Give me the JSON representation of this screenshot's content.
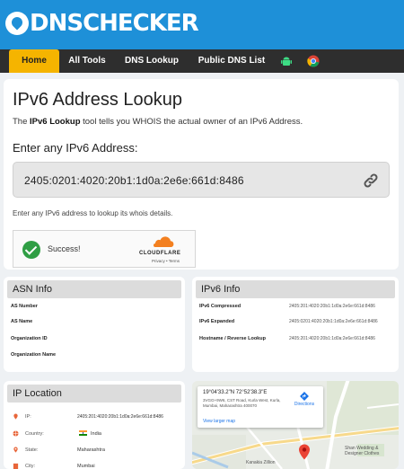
{
  "brand": {
    "dns": "DNS",
    "checker": "CHECKER"
  },
  "nav": {
    "items": [
      {
        "label": "Home",
        "active": true
      },
      {
        "label": "All Tools"
      },
      {
        "label": "DNS Lookup"
      },
      {
        "label": "Public DNS List"
      }
    ],
    "icons": [
      "android-icon",
      "chrome-icon"
    ]
  },
  "main": {
    "title": "IPv6 Address Lookup",
    "intro_pre": "The ",
    "intro_bold": "IPv6 Lookup",
    "intro_post": " tool tells you WHOIS the actual owner of an IPv6 Address.",
    "enter_label": "Enter any IPv6 Address:",
    "ip_value": "2405:0201:4020:20b1:1d0a:2e6e:661d:8486",
    "hint": "Enter any IPv6 address to lookup its whois details."
  },
  "turnstile": {
    "status": "Success!",
    "brand": "CLOUDFLARE",
    "links": "Privacy • Terms"
  },
  "asn": {
    "title": "ASN Info",
    "rows": [
      {
        "label": "AS Number",
        "value": ""
      },
      {
        "label": "AS Name",
        "value": ""
      },
      {
        "label": "Organization ID",
        "value": ""
      },
      {
        "label": "Organization Name",
        "value": ""
      }
    ]
  },
  "ipv6_info": {
    "title": "IPv6 Info",
    "rows": [
      {
        "label": "IPv6 Compressed",
        "value": "2405:201:4020:20b1:1d0a:2e6e:661d:8486"
      },
      {
        "label": "IPv6 Expanded",
        "value": "2405:0201:4020:20b1:1d0a:2e6e:661d:8486"
      },
      {
        "label": "Hostname / Reverse Lookup",
        "value": "2405:201:4020:20b1:1d0a:2e6e:661d:8486"
      }
    ]
  },
  "location": {
    "title": "IP Location",
    "rows": [
      {
        "label": "IP:",
        "value": "2405:201:4020:20b1:1d0a:2e6e:661d:8486",
        "icon": "map-pin-icon"
      },
      {
        "label": "Country:",
        "value": "India",
        "icon": "globe-icon"
      },
      {
        "label": "State:",
        "value": "Maharashtra",
        "icon": "location-icon"
      },
      {
        "label": "City:",
        "value": "Mumbai",
        "icon": "building-icon"
      }
    ]
  },
  "map": {
    "coord": "19°04'33.2\"N 72°52'38.3\"E",
    "address": "3VGG+9W6, CST Road, Kurla West, Kurla, Mumbai, Maharashtra 400070",
    "larger_link": "View larger map",
    "directions": "Directions",
    "places": [
      "Kanakia Zillion",
      "Shan Wedding & Designer Clothes",
      "Maharaj's...",
      "Ladies Tailor",
      "Kurla",
      "Bhabha",
      "Hospital",
      "Nehru Nagar",
      "Mani Rd 7",
      "Shopping",
      "MHADA Colony",
      "Kanakia Zillion"
    ]
  },
  "colors": {
    "header": "#1e90d8",
    "nav": "#2e2e2e",
    "active": "#f5b400",
    "success": "#2f9e44",
    "link": "#1a73e8"
  }
}
